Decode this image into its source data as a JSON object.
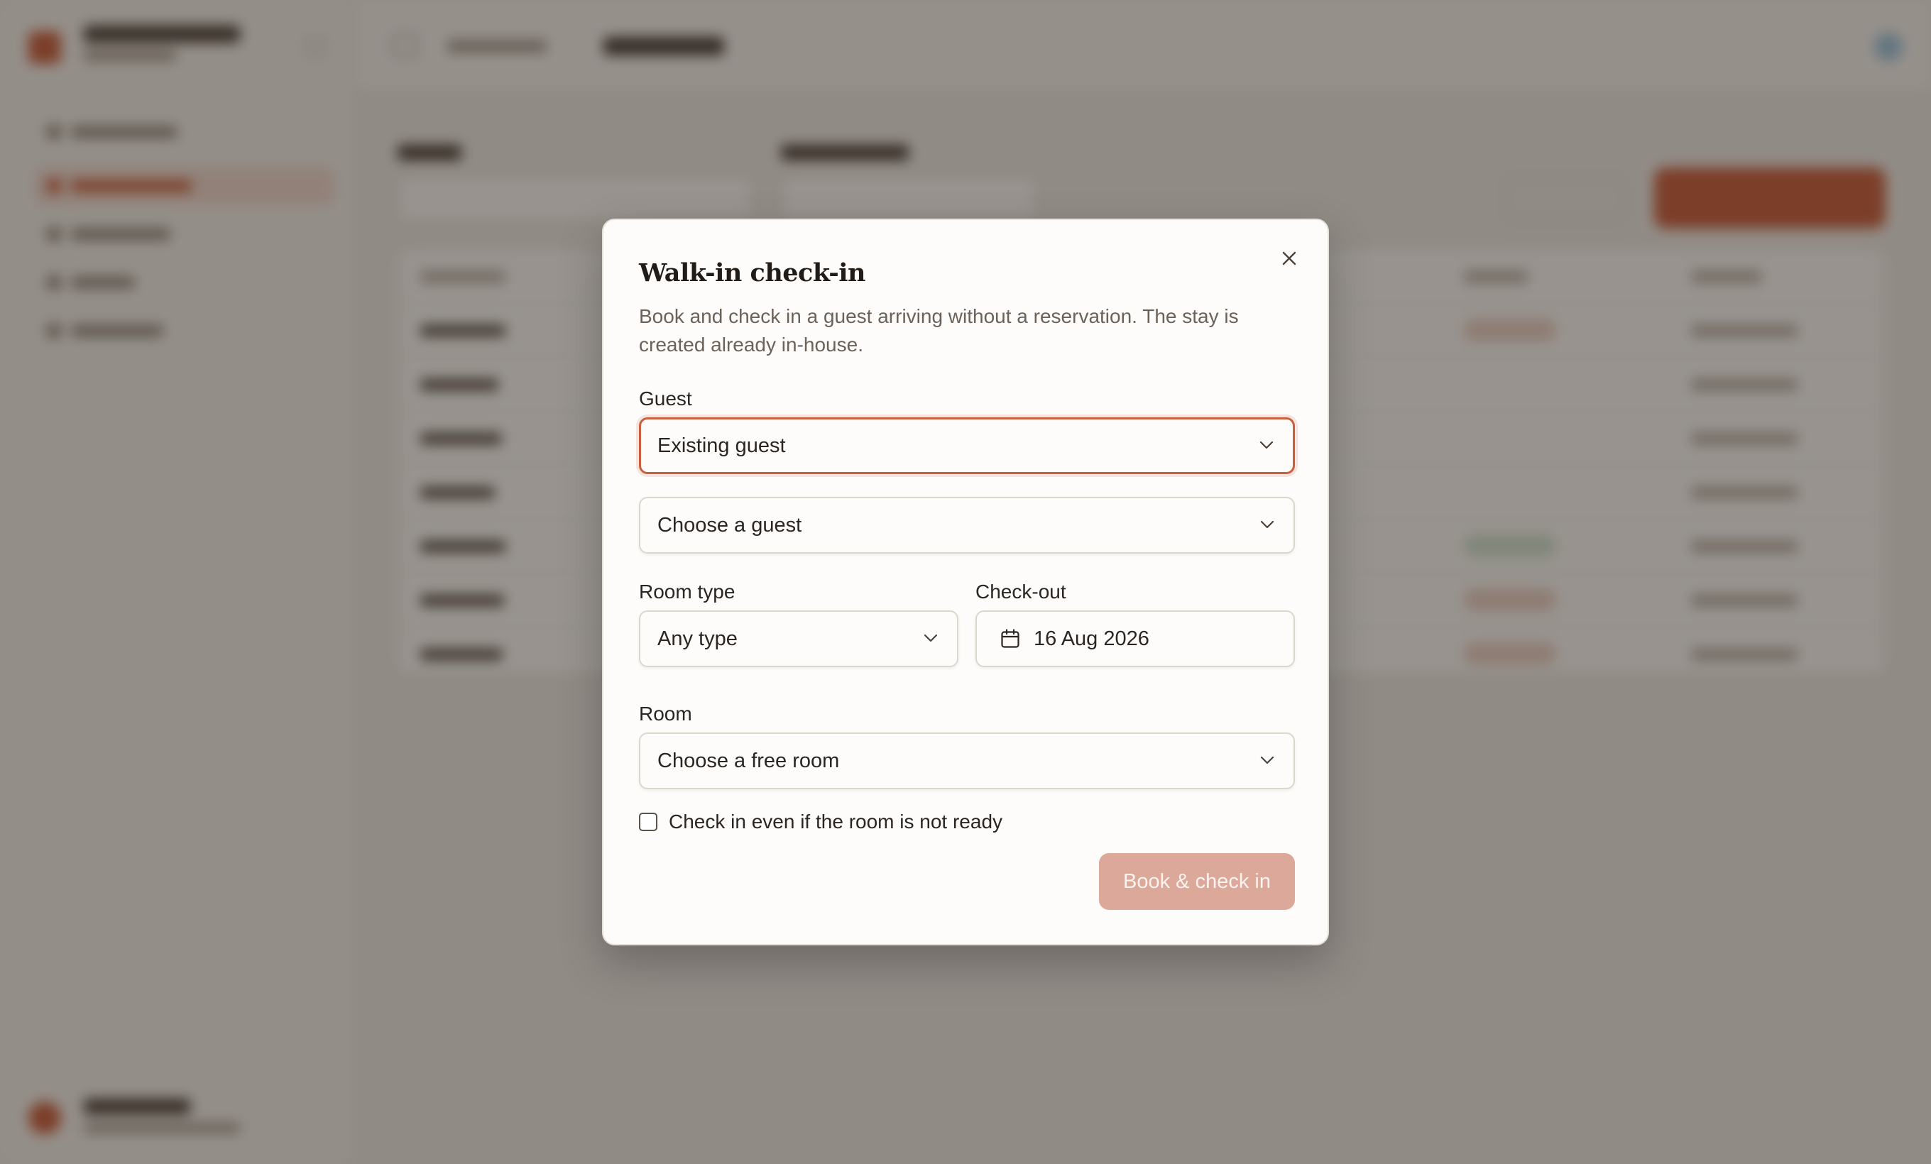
{
  "modal": {
    "title": "Walk-in check-in",
    "description": "Book and check in a guest arriving without a reservation. The stay is created already in-house.",
    "close_icon": "close-icon",
    "guest": {
      "label": "Guest",
      "mode_value": "Existing guest",
      "guest_value": "Choose a guest"
    },
    "room_type": {
      "label": "Room type",
      "value": "Any type"
    },
    "checkout": {
      "label": "Check-out",
      "value": "16 Aug 2026",
      "icon": "calendar-icon"
    },
    "room": {
      "label": "Room",
      "value": "Choose a free room"
    },
    "force_checkin": {
      "label": "Check in even if the room is not ready",
      "checked": false
    },
    "submit_label": "Book & check in"
  },
  "colors": {
    "accent": "#c8603f",
    "submit_disabled": "#dba89a",
    "overlay": "rgba(30,22,16,0.45)"
  }
}
